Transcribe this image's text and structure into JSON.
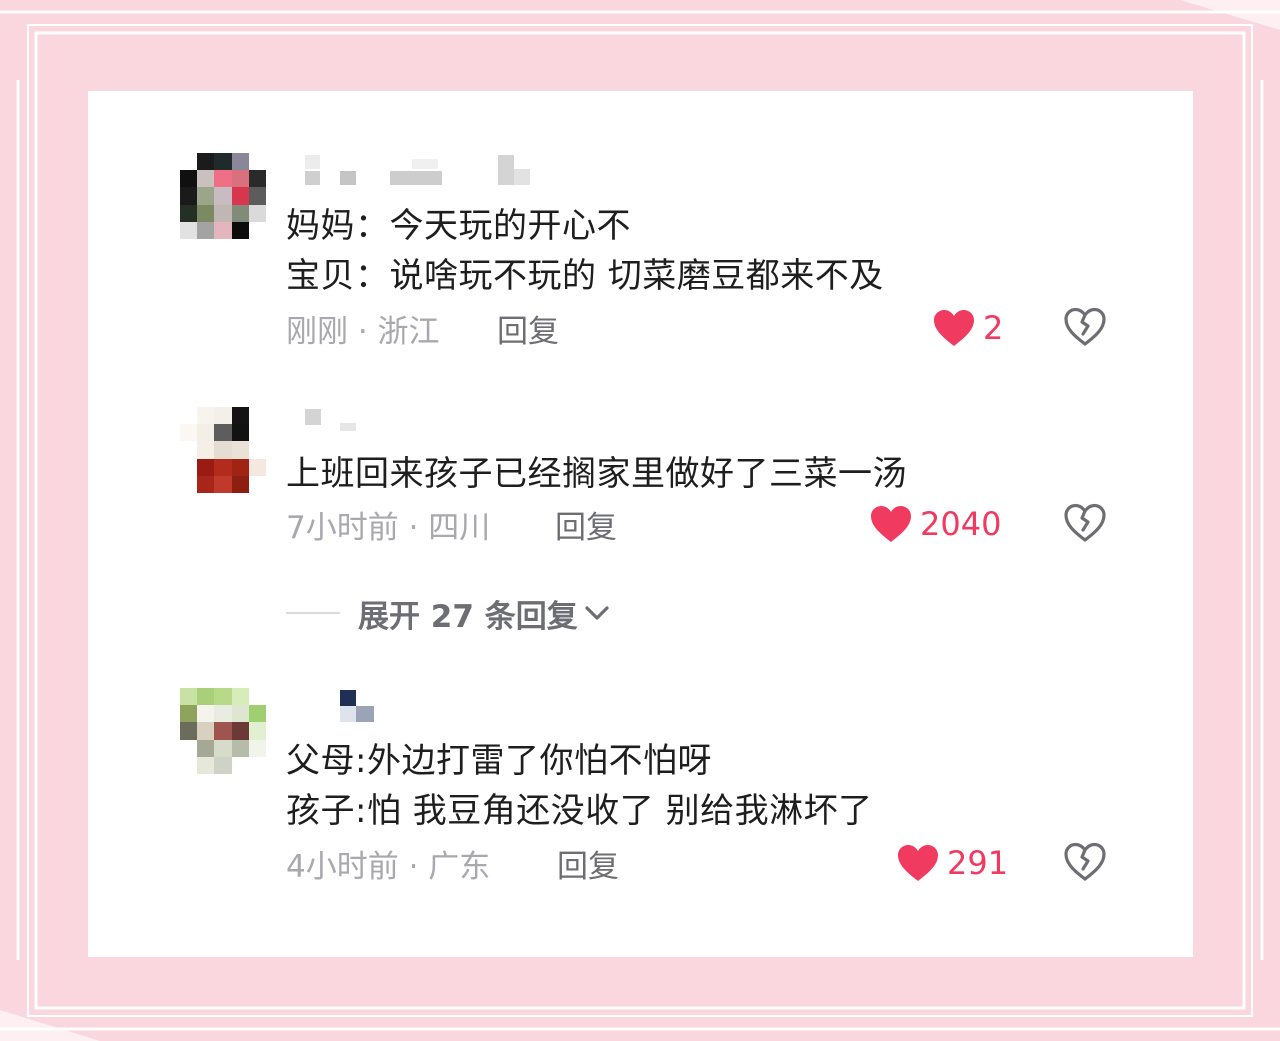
{
  "colors": {
    "background_pink": "#fad6df",
    "frame_line": "#ffffff",
    "like_red": "#f03a5f",
    "meta_gray": "#a8a8ae"
  },
  "comments": [
    {
      "lines": [
        "妈妈：今天玩的开心不",
        "宝贝：说啥玩不玩的 切菜磨豆都来不及"
      ],
      "time": "刚刚",
      "location": "浙江",
      "meta": "刚刚 · 浙江",
      "reply_label": "回复",
      "likes": "2",
      "like_icon": "heart-filled-icon",
      "dislike_icon": "broken-heart-icon"
    },
    {
      "lines": [
        "上班回来孩子已经搁家里做好了三菜一汤"
      ],
      "time": "7小时前",
      "location": "四川",
      "meta": "7小时前 · 四川",
      "reply_label": "回复",
      "likes": "2040",
      "like_icon": "heart-filled-icon",
      "dislike_icon": "broken-heart-icon",
      "expand_replies": "展开 27 条回复"
    },
    {
      "lines": [
        "父母:外边打雷了你怕不怕呀",
        "孩子:怕 我豆角还没收了 别给我淋坏了"
      ],
      "time": "4小时前",
      "location": "广东",
      "meta": "4小时前 · 广东",
      "reply_label": "回复",
      "likes": "291",
      "like_icon": "heart-filled-icon",
      "dislike_icon": "broken-heart-icon"
    }
  ]
}
